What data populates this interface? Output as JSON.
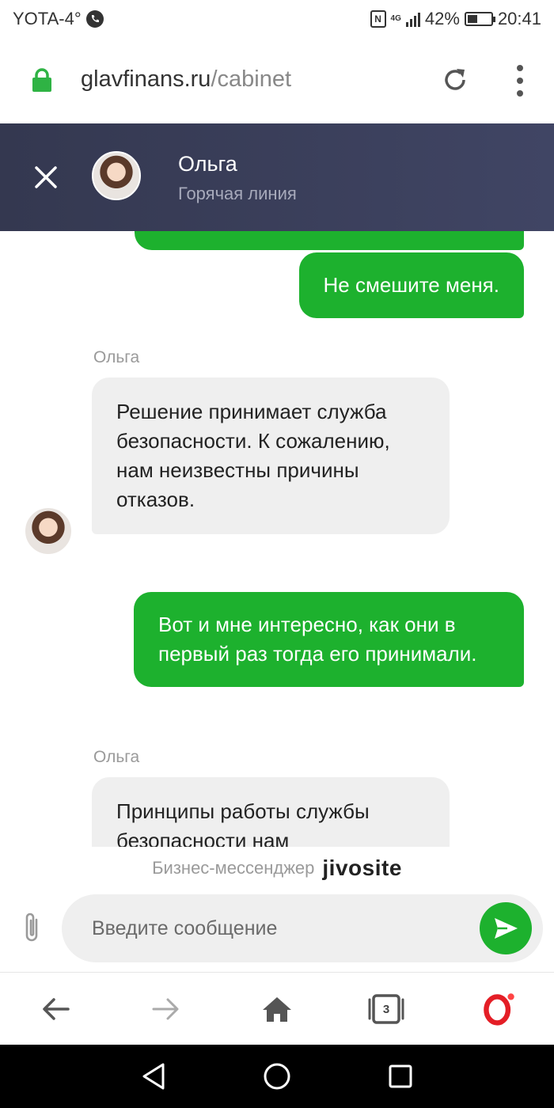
{
  "status_bar": {
    "carrier": "YOTA-4°",
    "network_type": "4G",
    "battery_percent": "42%",
    "battery_level": 0.42,
    "time": "20:41"
  },
  "browser": {
    "url_domain": "glavfinans.ru",
    "url_path": "/cabinet",
    "tabs_count": "3"
  },
  "chat_header": {
    "agent_name": "Ольга",
    "agent_role": "Горячая линия"
  },
  "messages": [
    {
      "direction": "out",
      "text": "Не смешите меня."
    },
    {
      "direction": "in",
      "sender": "Ольга",
      "text": "Решение принимает служба безопасности. К сожалению, нам неизвестны причины отказов."
    },
    {
      "direction": "out",
      "text": "Вот и мне интересно, как они в первый раз тогда его принимали."
    },
    {
      "direction": "in",
      "sender": "Ольга",
      "text": "Принципы работы службы безопасности нам"
    }
  ],
  "branding": {
    "text": "Бизнес-мессенджер",
    "logo": "jivosite"
  },
  "input": {
    "placeholder": "Введите сообщение",
    "value": ""
  },
  "colors": {
    "accent_green": "#1db12e",
    "header_bg": "#3a3f5a",
    "incoming_bubble": "#efefef"
  },
  "icons": {
    "lock": "lock-icon",
    "reload": "reload-icon",
    "menu": "menu-icon",
    "close": "close-icon",
    "attach": "paperclip-icon",
    "send": "send-icon",
    "back": "back-arrow-icon",
    "forward": "forward-arrow-icon",
    "home": "home-icon",
    "tabs": "tabs-icon",
    "opera": "opera-icon"
  }
}
